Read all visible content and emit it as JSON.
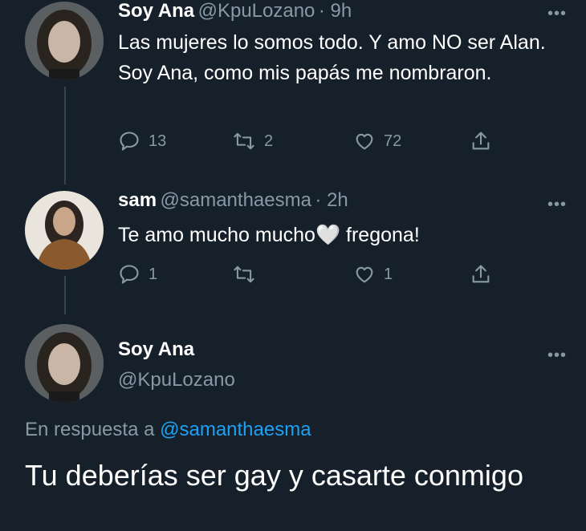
{
  "tweets": [
    {
      "name": "Soy Ana",
      "handle": "@KpuLozano",
      "time": "· 9h",
      "text": "Las mujeres lo somos todo. Y amo NO ser Alan. Soy Ana, como mis papás me nombraron.",
      "replies": "13",
      "retweets": "2",
      "likes": "72"
    },
    {
      "name": "sam",
      "handle": "@samanthaesma",
      "time": "· 2h",
      "text_before": "Te amo mucho mucho",
      "text_emoji": "🤍",
      "text_after": " fregona!",
      "replies": "1",
      "retweets": "",
      "likes": "1"
    }
  ],
  "main": {
    "name": "Soy Ana",
    "handle": "@KpuLozano",
    "reply_prefix": "En respuesta a",
    "reply_to": "@samanthaesma",
    "text": "Tu deberías ser gay y casarte conmigo"
  },
  "more_label": "•••",
  "colors": {
    "background": "#15202b",
    "muted": "#8899a6",
    "link": "#1da1f2",
    "thread_line": "#38444d"
  },
  "icons": [
    "reply-icon",
    "retweet-icon",
    "like-icon",
    "share-icon",
    "more-icon"
  ]
}
